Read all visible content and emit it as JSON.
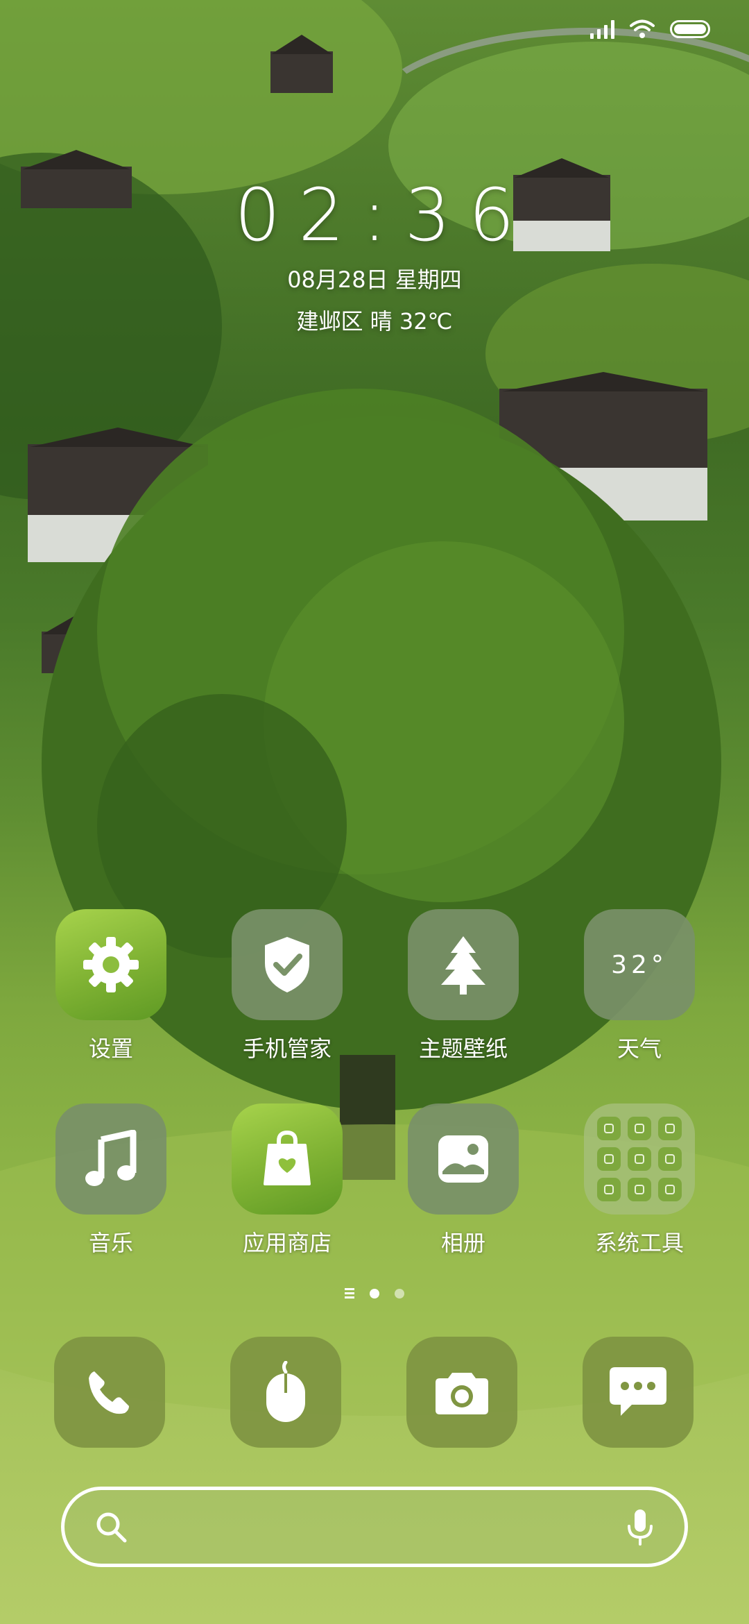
{
  "status_bar": {
    "signal_icon": "signal-bars-icon",
    "wifi_icon": "wifi-icon",
    "battery_icon": "battery-icon"
  },
  "clock": {
    "time": "02:36",
    "date": "08月28日 星期四",
    "weather": "建邺区 晴 32℃"
  },
  "apps": [
    {
      "label": "设置",
      "icon": "gear-icon"
    },
    {
      "label": "手机管家",
      "icon": "shield-check-icon"
    },
    {
      "label": "主题壁纸",
      "icon": "tree-icon"
    },
    {
      "label": "天气",
      "icon": "weather-temp-icon",
      "tile_text": "32°"
    },
    {
      "label": "音乐",
      "icon": "music-note-icon"
    },
    {
      "label": "应用商店",
      "icon": "shopping-bag-icon"
    },
    {
      "label": "相册",
      "icon": "photo-icon"
    },
    {
      "label": "系统工具",
      "icon": "folder-icon"
    }
  ],
  "page_indicator": {
    "pages": 2,
    "current": 1
  },
  "dock": [
    {
      "icon": "phone-icon"
    },
    {
      "icon": "browser-icon"
    },
    {
      "icon": "camera-icon"
    },
    {
      "icon": "message-icon"
    }
  ],
  "search": {
    "placeholder": "",
    "search_icon": "search-icon",
    "mic_icon": "microphone-icon"
  },
  "colors": {
    "tile": "#789068",
    "dock_tile": "#809642",
    "accent_green": "#7fb233"
  }
}
